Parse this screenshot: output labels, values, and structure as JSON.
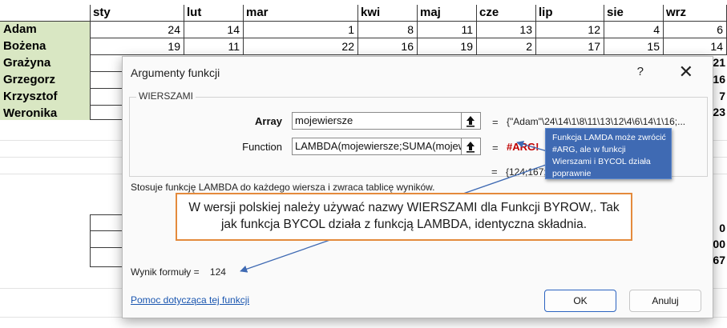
{
  "sheet": {
    "months": [
      "sty",
      "lut",
      "mar",
      "kwi",
      "maj",
      "cze",
      "lip",
      "sie",
      "wrz"
    ],
    "rows": [
      {
        "name": "Adam",
        "values": [
          "24",
          "14",
          "1",
          "8",
          "11",
          "13",
          "12",
          "4",
          "6"
        ]
      },
      {
        "name": "Bożena",
        "values": [
          "19",
          "11",
          "22",
          "16",
          "19",
          "2",
          "17",
          "15",
          "14"
        ]
      },
      {
        "name": "Grażyna",
        "edge": "21"
      },
      {
        "name": "Grzegorz",
        "edge": "16"
      },
      {
        "name": "Krzysztof",
        "edge": "7"
      },
      {
        "name": "Weronika",
        "edge": "23"
      }
    ],
    "lower_edges": [
      "0",
      "00",
      "67"
    ]
  },
  "dialog": {
    "title": "Argumenty funkcji",
    "help_symbol": "?",
    "close_symbol": "✕",
    "group_name": "WIERSZAMI",
    "args": [
      {
        "label": "Array",
        "value": "mojewiersze",
        "result": "{\"Adam\"\\24\\14\\1\\8\\11\\13\\12\\4\\6\\14\\1\\16;..."
      },
      {
        "label": "Function",
        "value": "LAMBDA(mojewiersze;SUMA(mojewier",
        "result": "#ARG!"
      }
    ],
    "equals": "=",
    "overall_result": "{124;167;",
    "description": "Stosuje funkcję LAMBDA do każdego wiersza i zwraca tablicę wyników.",
    "formula_label": "Wynik formuły =",
    "formula_value": "124",
    "help_link": "Pomoc dotycząca tej funkcji",
    "ok_label": "OK",
    "cancel_label": "Anuluj"
  },
  "callouts": {
    "blue_text": "Funkcja LAMDA może zwrócić #ARG, ale w funkcji Wierszami i BYCOL działa poprawnie",
    "orange_text": "W wersji polskiej należy używać nazwy WIERSZAMI dla Funkcji BYROW,. Tak jak funkcja BYCOL działa z funkcją LAMBDA, identyczna składnia."
  },
  "colors": {
    "name_fill": "#d9e7c3",
    "error_red": "#c00000",
    "callout_blue": "#3f6ab3",
    "callout_orange": "#e48a3c",
    "link_blue": "#1a56b0"
  }
}
